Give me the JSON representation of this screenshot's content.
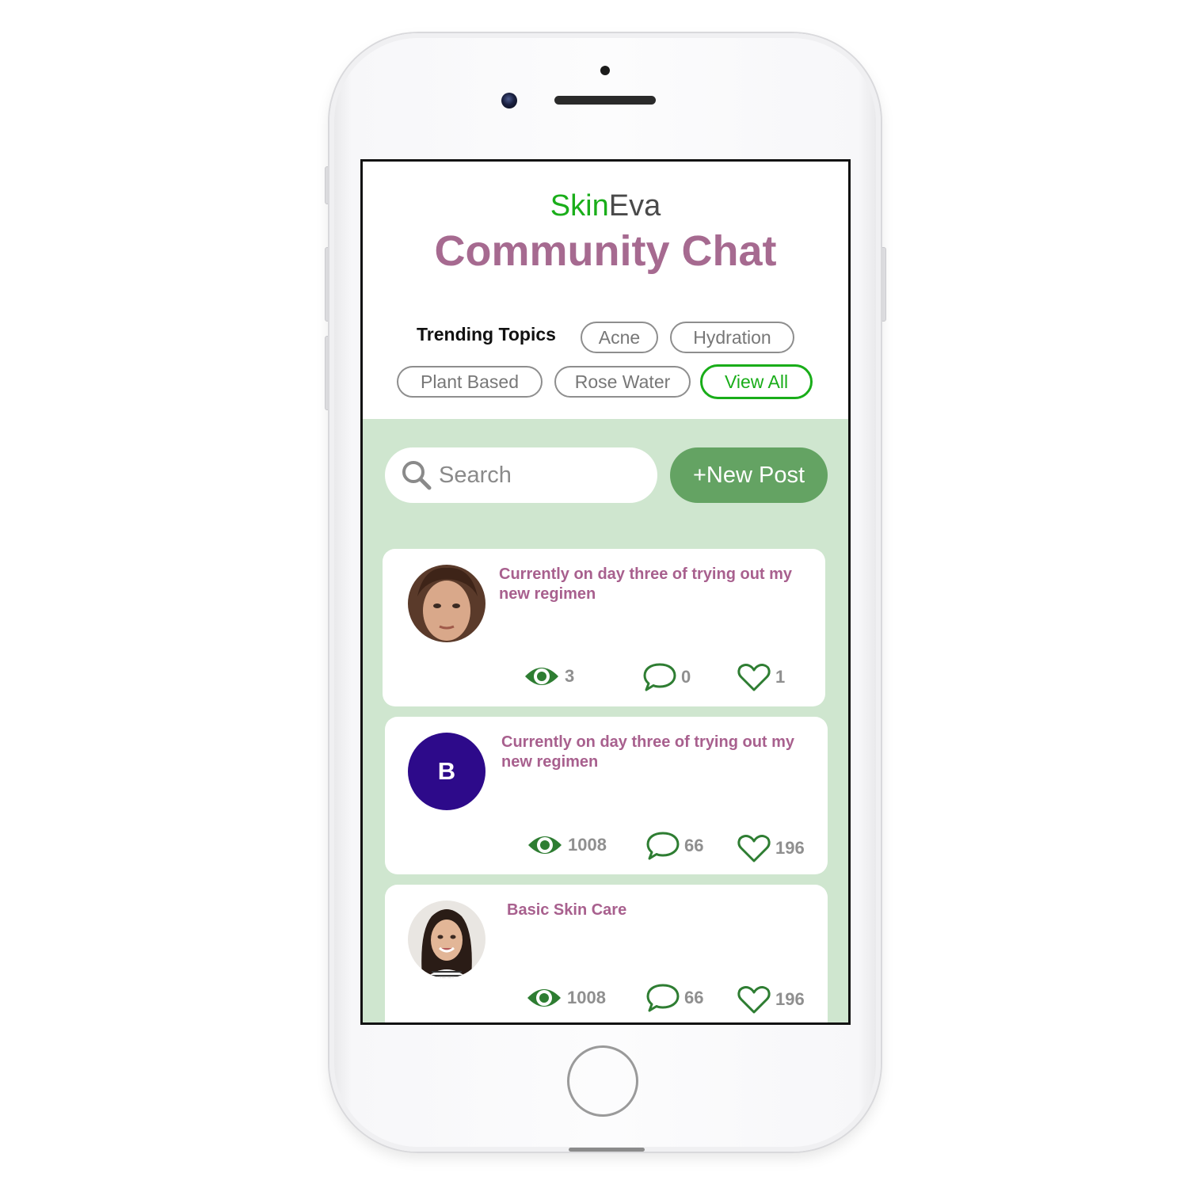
{
  "app": {
    "brand_part1": "Skin",
    "brand_part2": "Eva",
    "title": "Community Chat"
  },
  "trending": {
    "label": "Trending Topics",
    "chips": [
      "Acne",
      "Hydration",
      "Plant Based",
      "Rose Water"
    ],
    "view_all": "View All"
  },
  "search": {
    "placeholder": "Search",
    "icon": "search-icon"
  },
  "new_post_label": "+New Post",
  "posts": [
    {
      "avatar": "photo",
      "text": "Currently on day three of trying out my new regimen",
      "views": "3",
      "comments": "0",
      "likes": "1"
    },
    {
      "avatar": "letter",
      "avatar_letter": "B",
      "text": "Currently on day three of trying out my new regimen",
      "views": "1008",
      "comments": "66",
      "likes": "196"
    },
    {
      "avatar": "photo",
      "text": "Basic Skin Care",
      "views": "1008",
      "comments": "66",
      "likes": "196"
    }
  ],
  "colors": {
    "brand_green": "#1aae1a",
    "title_pink": "#a66a90",
    "panel_green": "#cfe6cf",
    "button_green": "#64a363",
    "icon_green": "#2e7d32",
    "avatar_purple": "#2d0a8a"
  }
}
